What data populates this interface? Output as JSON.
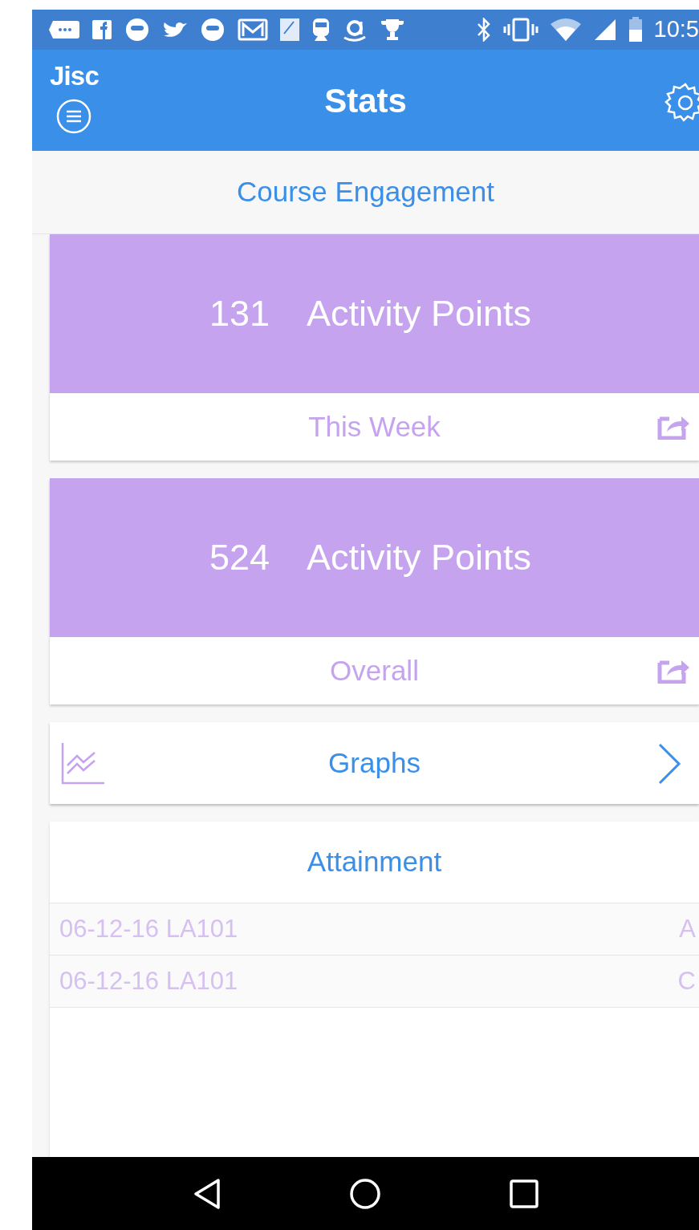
{
  "status_bar": {
    "time": "10:5"
  },
  "header": {
    "brand": "Jisc",
    "title": "Stats"
  },
  "section_title": "Course Engagement",
  "stat_cards": [
    {
      "value": "131",
      "unit": "Activity Points",
      "period": "This Week"
    },
    {
      "value": "524",
      "unit": "Activity Points",
      "period": "Overall"
    }
  ],
  "graphs_link": {
    "label": "Graphs"
  },
  "attainment": {
    "title": "Attainment",
    "rows": [
      {
        "label": "06-12-16 LA101",
        "grade": "A"
      },
      {
        "label": "06-12-16 LA101",
        "grade": "C"
      }
    ]
  }
}
